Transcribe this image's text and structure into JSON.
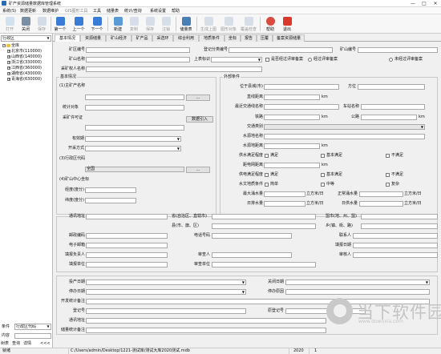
{
  "app": {
    "title": "矿产资源储量数据库管理系统"
  },
  "window": {
    "minimize": "—",
    "maximize": "□",
    "close": "✕"
  },
  "menu": [
    "系统(S)",
    "数据更新",
    "数据维护",
    "GIS图形工具",
    "工具",
    "储量表",
    "统计/查询",
    "系统设置",
    "帮助"
  ],
  "toolbar": [
    {
      "label": "打开",
      "icon": "open-icon",
      "color": "#8fb4d9",
      "disabled": true
    },
    {
      "label": "关闭",
      "icon": "close-doc-icon",
      "color": "#7a8fa6",
      "disabled": false
    },
    {
      "label": "保存",
      "icon": "save-icon",
      "color": "#8fa9c9",
      "disabled": true
    },
    {
      "label": "第一个",
      "icon": "first-record-icon",
      "color": "#3a7bd5",
      "disabled": false
    },
    {
      "label": "上一个",
      "icon": "prev-record-icon",
      "color": "#3a7bd5",
      "disabled": false
    },
    {
      "label": "下一个",
      "icon": "next-record-icon",
      "color": "#3a7bd5",
      "disabled": false
    },
    {
      "label": "新建",
      "icon": "new-icon",
      "color": "#5b9bd5",
      "disabled": false
    },
    {
      "label": "复制",
      "icon": "copy-icon",
      "color": "#9ab0c8",
      "disabled": true
    },
    {
      "label": "保存",
      "icon": "save2-icon",
      "color": "#9ab0c8",
      "disabled": true
    },
    {
      "label": "注销",
      "icon": "delete-icon",
      "color": "#9ab0c8",
      "disabled": true
    },
    {
      "label": "储量表",
      "icon": "reserve-table-icon",
      "color": "#4a7fb5",
      "disabled": false
    },
    {
      "label": "生成上图",
      "icon": "map-up-icon",
      "color": "#9ab0c8",
      "disabled": true
    },
    {
      "label": "图形对象",
      "icon": "graphic-object-icon",
      "color": "#9ab0c8",
      "disabled": true
    },
    {
      "label": "覆盖检查",
      "icon": "overlap-check-icon",
      "color": "#9ab0c8",
      "disabled": true
    },
    {
      "label": "帮助",
      "icon": "help-icon",
      "color": "#d94b3f",
      "disabled": false
    },
    {
      "label": "退出",
      "icon": "exit-icon",
      "color": "#d9382b",
      "disabled": false
    }
  ],
  "left": {
    "filter_value": "行政区",
    "tree": [
      {
        "label": "全库",
        "level": 0,
        "expand": "−"
      },
      {
        "label": "北京市(110000)",
        "level": 1,
        "expand": "+"
      },
      {
        "label": "山西省(140000)",
        "level": 1,
        "expand": "+"
      },
      {
        "label": "浙江省(330000)",
        "level": 1,
        "expand": "+"
      },
      {
        "label": "江西省(360000)",
        "level": 1,
        "expand": "+"
      },
      {
        "label": "湖南省(430000)",
        "level": 1,
        "expand": "+"
      },
      {
        "label": "青海省(630000)",
        "level": 1,
        "expand": "+"
      }
    ],
    "cond_label": "条件",
    "cond_value": "行政区代码",
    "content_label": "内容",
    "bottom_tabs": [
      "树表",
      "查询",
      "详情"
    ],
    "more": "<<<"
  },
  "tabs": [
    "基本情况",
    "资源储量",
    "矿山经济",
    "矿产品",
    "采选环",
    "综合利用",
    "地质条件",
    "坐标",
    "报告",
    "压覆",
    "备案资源储量"
  ],
  "form": {
    "mine_code": "矿区编号",
    "register_no": "登记分类编号",
    "mine_no": "矿山编号",
    "mine_name": "矿山名称",
    "superior": "上表标识",
    "review_q": "是否经过评审备案",
    "reviewed": "经过评审备案",
    "not_reviewed": "未经过评审备案",
    "owner": "采矿权人名称",
    "basic_group": "基本情况",
    "main_mineral": "(1)主矿产名称",
    "stat_object": "统计对象",
    "mining_license": "采矿许可证",
    "import_btn": "数据引入",
    "expiry": "有效期",
    "mining_type": "开采方式",
    "admin_code": "(3)行政区代码",
    "admin_value": "全国",
    "center_coord": "(4)矿山中心坐标",
    "lon": "经度(度分)",
    "lat": "纬度(度分)",
    "ellipsis": "...",
    "ext_group": "外部条件",
    "location": "位于县城(市)",
    "direction": "方位",
    "distance": "直线距离",
    "km": "km",
    "nearest_station": "最近交通线名称",
    "station_name": "车站名称",
    "railway": "铁路",
    "highway": "公路",
    "transport": "交通类别",
    "water_source": "水源地名称",
    "water_distance": "水源地距离",
    "water_supply": "供水满足程度",
    "satisfy": "满足",
    "basic_satisfy": "基本满足",
    "not_satisfy": "不满足",
    "power_distance": "距电网距离",
    "power_supply": "供电满足程度",
    "hydro_condition": "水文地质条件",
    "simple": "简单",
    "medium": "中等",
    "complex": "复杂",
    "max_inflow": "最大涌水量",
    "normal_inflow": "正常涌水量",
    "unit_m3": "立方米/日",
    "daily_water": "日排水量",
    "daily_water2": "日供水量",
    "address": "通讯地址",
    "province": "省(自治区、直辖市)",
    "city": "盟市(地、州、盟)",
    "county": "县(市、旗、区)",
    "town": "乡(镇、街、路)",
    "postal": "邮政编码",
    "phone": "电话号码",
    "contact": "联系人",
    "email": "电子邮箱",
    "fill_date": "填报日期",
    "fill_person": "填报负责人",
    "reviewer": "审查人",
    "reviewer2": "审核人",
    "fill_unit": "填报单位",
    "review_unit": "审查单位",
    "prod_date": "投产日期",
    "close_date": "关闭日期",
    "stop_date": "停办日期",
    "stop_reason": "停办原因",
    "dev_notes": "开发统计备注",
    "reg_no": "登记号",
    "cert_no": "原登记号",
    "contact_addr": "通讯地址",
    "reserve_notes": "储量统计备注"
  },
  "status": {
    "ready": "就绪",
    "path": "C:/Users/admin/Desktop/1221-测试库/测试大库2020测试.mdb",
    "year": "2020",
    "page": "1"
  },
  "watermark": {
    "text": "当下软件园",
    "sub": "www.downxia.com"
  }
}
